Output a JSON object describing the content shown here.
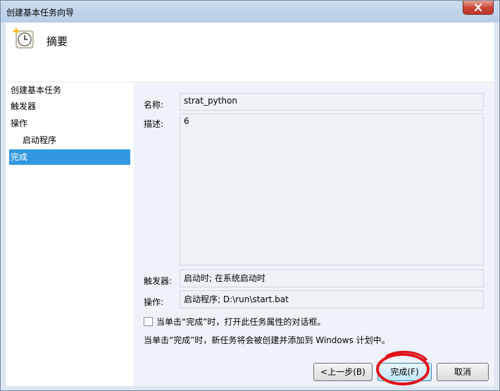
{
  "window": {
    "title": "创建基本任务向导"
  },
  "header": {
    "title": "摘要",
    "icon": "clock-sparkle-icon"
  },
  "sidebar": {
    "items": [
      {
        "label": "创建基本任务",
        "active": false,
        "sub": false
      },
      {
        "label": "触发器",
        "active": false,
        "sub": false
      },
      {
        "label": "操作",
        "active": false,
        "sub": false
      },
      {
        "label": "启动程序",
        "active": false,
        "sub": true
      },
      {
        "label": "完成",
        "active": true,
        "sub": false
      }
    ]
  },
  "form": {
    "name_label": "名称:",
    "name_value": "strat_python",
    "desc_label": "描述:",
    "desc_value": "6",
    "trigger_label": "触发器:",
    "trigger_value": "启动时; 在系统启动时",
    "action_label": "操作:",
    "action_value": "启动程序; D:\\run\\start.bat"
  },
  "checkbox": {
    "label": "当单击“完成”时，打开此任务属性的对话框。",
    "checked": false
  },
  "info_text": "当单击“完成”时，新任务将会被创建并添加到 Windows 计划中。",
  "buttons": {
    "back": "<上一步(B)",
    "finish": "完成(F)",
    "cancel": "取消"
  },
  "colors": {
    "selection": "#3399e0",
    "annotation": "#e0101a"
  }
}
